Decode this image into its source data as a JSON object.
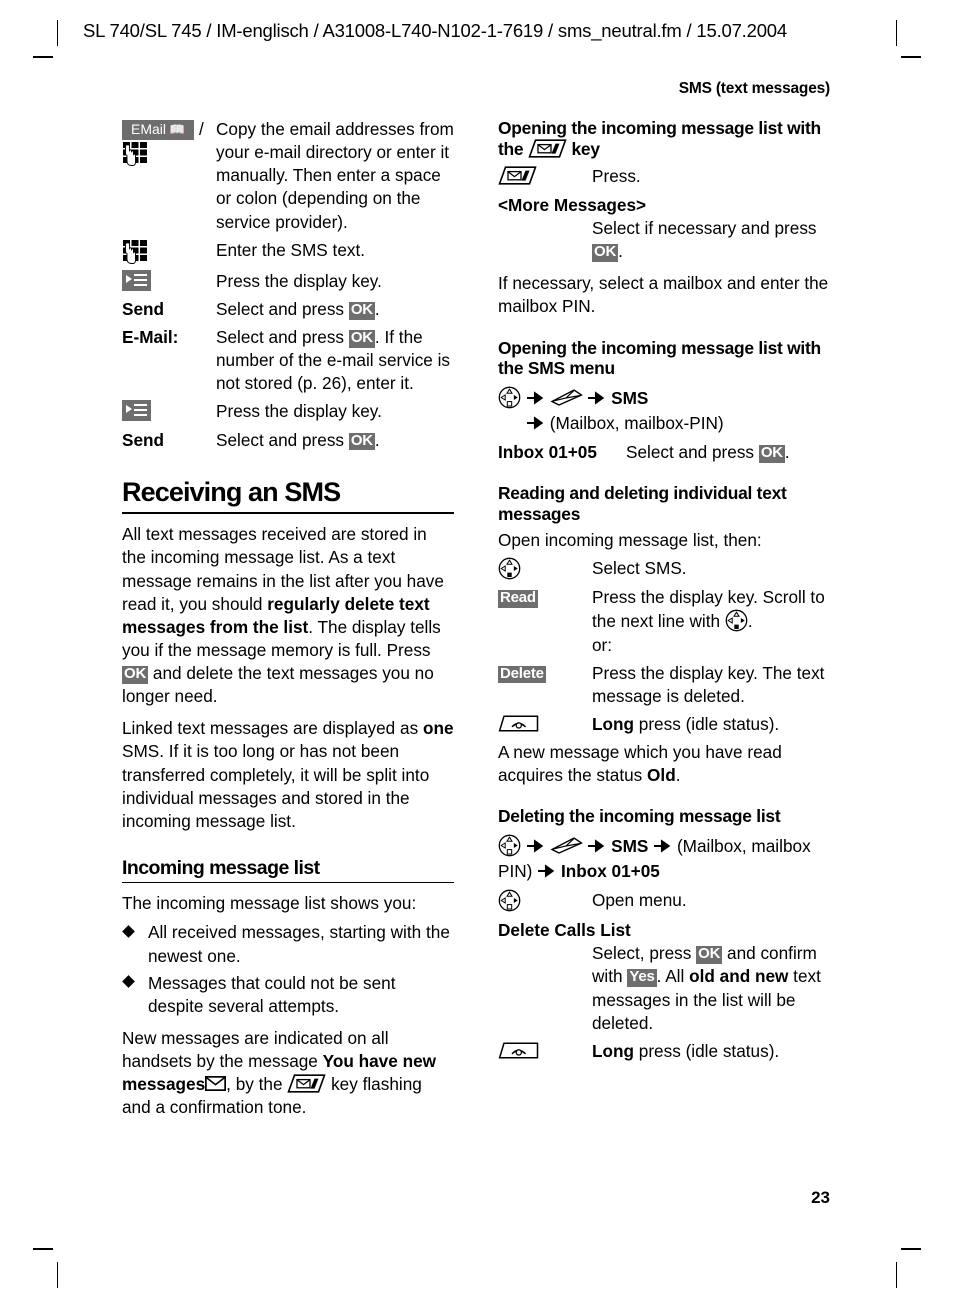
{
  "header": {
    "running_head": "SL 740/SL 745 / IM-englisch / A31008-L740-N102-1-7619 / sms_neutral.fm / 15.07.2004",
    "section_title": "SMS (text messages)"
  },
  "folio": {
    "page_number": "23"
  },
  "colors": {
    "badge_gray": "#6e6e6e",
    "text": "#000000",
    "page_background": "#ffffff"
  },
  "left_column": {
    "email_row": {
      "badge_label": "EMail",
      "badge_icon": "book-icon",
      "separator": "/",
      "keypad_icon": "keypad-hand-icon",
      "description": "Copy the email addresses from your e-mail directory or enter it manually. Then enter a space or colon (depending on the service provider)."
    },
    "steps": [
      {
        "term": "",
        "term_icon": "keypad-hand-icon",
        "desc": "Enter the SMS text."
      },
      {
        "term": "",
        "term_icon": "display-key-icon",
        "desc": "Press the display key."
      },
      {
        "term": "Send",
        "desc_pre": "Select and press ",
        "badge": "OK",
        "desc_post": "."
      },
      {
        "term": "E-Mail:",
        "desc_pre": "Select and press ",
        "badge": "OK",
        "desc_post": ". If the number of the e-mail service is not stored (p. 26), enter it."
      },
      {
        "term": "",
        "term_icon": "display-key-icon",
        "desc": "Press the display key."
      },
      {
        "term": "Send",
        "desc_pre": "Select and press ",
        "badge": "OK",
        "desc_post": "."
      }
    ],
    "heading_receiving": "Receiving an SMS",
    "para_receiving_1": {
      "part1": "All text messages received are stored in the incoming message list. As a text message remains in the list after you have read it, you should ",
      "bold1": "regularly delete text messages from the list",
      "part2": ". The display tells you if the message memory is full. Press ",
      "badge": "OK",
      "part3": " and delete the text messages you no longer need."
    },
    "para_receiving_2": {
      "part1": "Linked text messages are displayed as ",
      "bold1": "one",
      "part2": " SMS. If it is too long or has not been transferred completely, it will be split into individual messages and stored in the incoming message list."
    },
    "heading_incoming_list": "Incoming message list",
    "intro_incoming_list": "The incoming message list shows you:",
    "bullets": [
      "All received messages, starting with the newest one.",
      "Messages that could not be sent despite several attempts."
    ],
    "para_new_messages": {
      "part1": "New messages are indicated on all handsets by the message ",
      "bold1": "You have new messages",
      "envelope_icon": "envelope-icon",
      "part2": ", by the ",
      "msgkey_icon": "message-key-icon",
      "part3": " key flashing and a confirmation tone."
    }
  },
  "right_column": {
    "heading_open_with_key": {
      "part1": "Opening the incoming message list with the ",
      "icon": "message-key-icon",
      "part2": " key"
    },
    "press_row": {
      "icon": "message-key-icon",
      "desc": "Press."
    },
    "more_messages": {
      "term": "<More Messages>",
      "desc_pre": "Select if necessary and press ",
      "badge": "OK",
      "desc_post": "."
    },
    "para_mailbox_pin": "If necessary, select a mailbox and enter the mailbox PIN.",
    "heading_open_with_menu": "Opening the incoming message list with the SMS menu",
    "menu_path_1": {
      "nav_icon": "navigation-key-icon",
      "arrow": "arrow-right-icon",
      "env_icon": "envelope-menu-icon",
      "item_sms": "SMS",
      "tail": "(Mailbox, mailbox-PIN)"
    },
    "inbox_row": {
      "term": "Inbox 01+05",
      "desc_pre": "Select and press ",
      "badge": "OK",
      "desc_post": "."
    },
    "heading_reading_deleting": "Reading and deleting individual text messages",
    "intro_reading": "Open incoming message list, then:",
    "reading_steps": [
      {
        "icon": "navigation-key-icon",
        "desc": "Select SMS."
      },
      {
        "badge": "Read",
        "desc_pre": "Press the display key. Scroll to the next line with ",
        "desc_icon": "navigation-key-icon",
        "desc_post": ".",
        "extra": "or:"
      },
      {
        "badge": "Delete",
        "desc": "Press the display key. The text message is deleted."
      },
      {
        "icon": "end-key-icon",
        "bold": "Long",
        "desc": " press (idle status)."
      }
    ],
    "para_old_status": {
      "part1": "A new message which you have read acquires the status ",
      "bold1": "Old",
      "part2": "."
    },
    "heading_deleting_list": "Deleting the incoming message list",
    "menu_path_2": {
      "nav_icon": "navigation-key-icon",
      "env_icon": "envelope-menu-icon",
      "item_sms": "SMS",
      "mailbox": "(Mailbox, mailbox PIN)",
      "item_inbox": "Inbox 01+05"
    },
    "open_menu_row": {
      "icon": "navigation-key-icon",
      "desc": "Open menu."
    },
    "delete_calls_list": {
      "term": "Delete Calls List",
      "desc_pre": "Select, press ",
      "badge_ok": "OK",
      "desc_mid": " and confirm with ",
      "badge_yes": "Yes",
      "desc_mid2": ". All ",
      "bold_old_new": "old and new",
      "desc_post": " text messages in the list will be deleted."
    },
    "long_press_row": {
      "icon": "end-key-icon",
      "bold": "Long",
      "desc": " press (idle status)."
    }
  }
}
